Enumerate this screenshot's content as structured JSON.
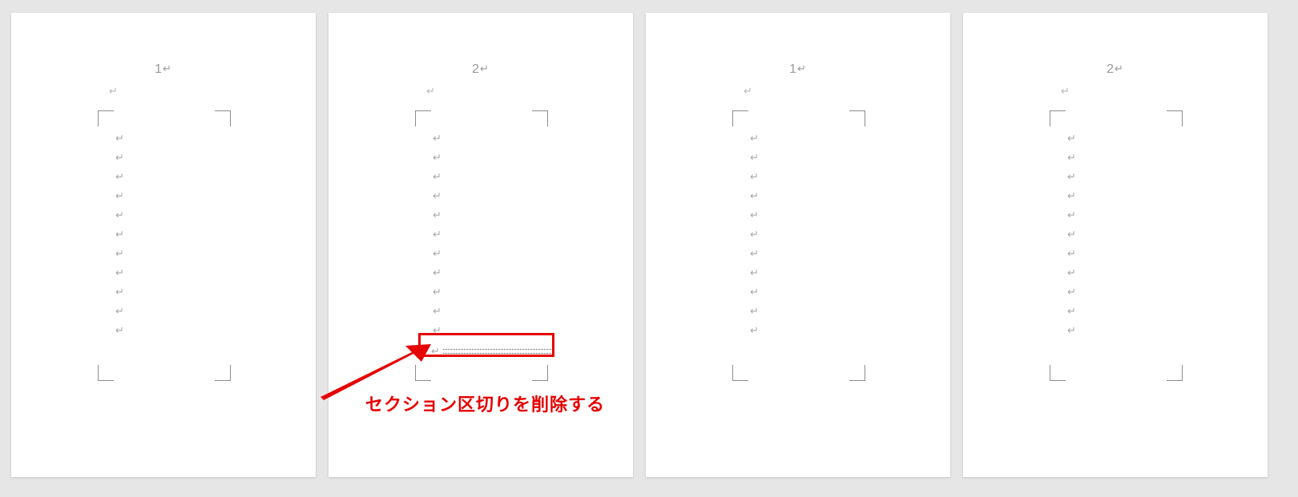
{
  "glyphs": {
    "paragraph_mark": "↵"
  },
  "pages": [
    {
      "header_number": "1",
      "paragraph_marks": 11,
      "has_section_break": false
    },
    {
      "header_number": "2",
      "paragraph_marks": 11,
      "has_section_break": true
    },
    {
      "header_number": "1",
      "paragraph_marks": 11,
      "has_section_break": false
    },
    {
      "header_number": "2",
      "paragraph_marks": 11,
      "has_section_break": false
    }
  ],
  "annotation": {
    "label": "セクション区切りを削除する"
  },
  "colors": {
    "annotation_red": "#e60000",
    "page_background": "#ffffff",
    "workspace_background": "#e6e6e6",
    "formatting_mark": "#a8a8a8"
  }
}
